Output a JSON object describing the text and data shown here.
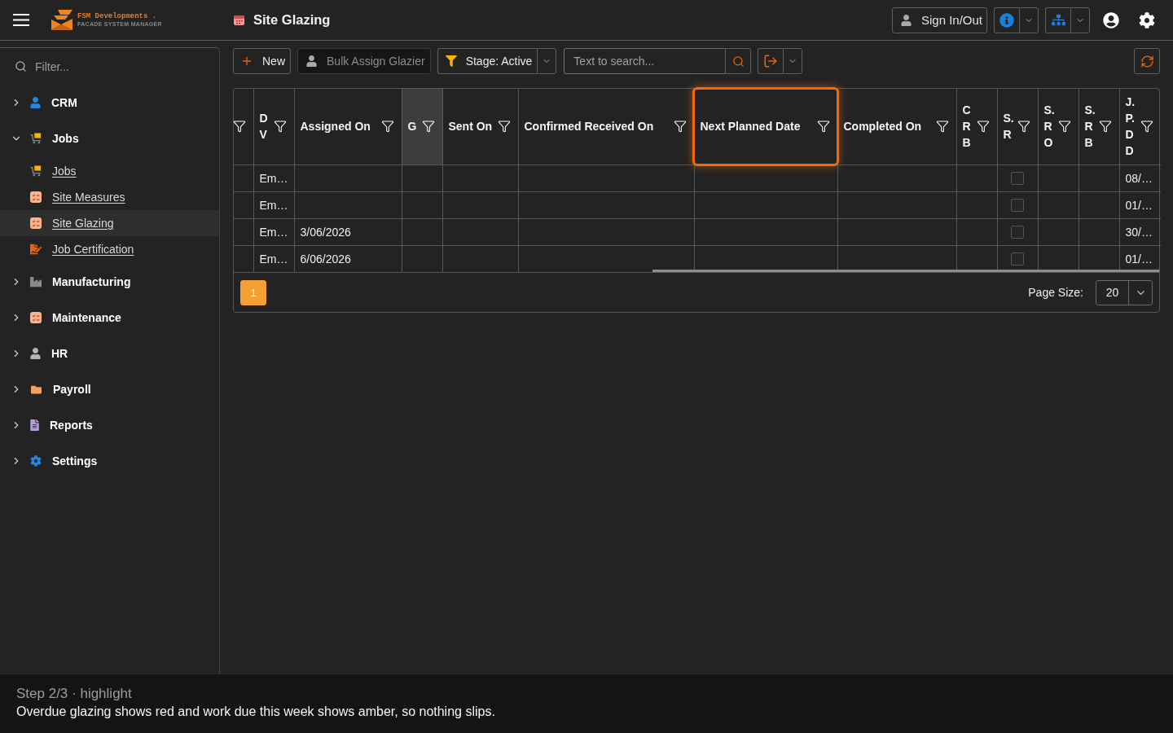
{
  "top_bar": {
    "brand_name": "FSM Developments .",
    "brand_tagline": "FACADE SYSTEM MANAGER",
    "page_title": "Site Glazing",
    "sign_in_button": "Sign In/Out"
  },
  "sidebar": {
    "filter": {
      "placeholder": "Filter..."
    },
    "items": [
      {
        "label": "CRM",
        "expanded": false
      },
      {
        "label": "Jobs",
        "expanded": true,
        "children": [
          {
            "label": "Jobs",
            "selected": false
          },
          {
            "label": "Site Measures",
            "selected": false
          },
          {
            "label": "Site Glazing",
            "selected": true
          },
          {
            "label": "Job Certification",
            "selected": false
          }
        ]
      },
      {
        "label": "Manufacturing",
        "expanded": false
      },
      {
        "label": "Maintenance",
        "expanded": false
      },
      {
        "label": "HR",
        "expanded": false
      },
      {
        "label": "Payroll",
        "expanded": false
      },
      {
        "label": "Reports",
        "expanded": false
      },
      {
        "label": "Settings",
        "expanded": false
      }
    ]
  },
  "toolbar": {
    "new_button": "New",
    "bulk_assign_button": {
      "label": "Bulk Assign Glazier",
      "disabled": true
    },
    "stage_filter": "Stage: Active",
    "search": {
      "placeholder": "Text to search..."
    }
  },
  "table": {
    "columns": [
      {
        "selected": false,
        "highlighted": false
      },
      {
        "label": "D V",
        "selected": false,
        "highlighted": false
      },
      {
        "label": "Assigned On",
        "selected": false,
        "highlighted": false
      },
      {
        "label": "G",
        "selected": true,
        "highlighted": false
      },
      {
        "label": "Sent On",
        "selected": false,
        "highlighted": false
      },
      {
        "label": "Confirmed Received On",
        "selected": false,
        "highlighted": false
      },
      {
        "label": "Next Planned Date",
        "selected": false,
        "highlighted": true
      },
      {
        "label": "Completed On",
        "selected": false,
        "highlighted": false
      },
      {
        "label": "C R B",
        "selected": false,
        "highlighted": false
      },
      {
        "label": "S. R",
        "selected": false,
        "highlighted": false
      },
      {
        "label": "S. R O",
        "selected": false,
        "highlighted": false
      },
      {
        "label": "S. R B",
        "selected": false,
        "highlighted": false
      },
      {
        "label": "J. P. D D",
        "selected": false,
        "highlighted": false
      }
    ],
    "rows": [
      {
        "d_v": "Em…",
        "s_r": {
          "checked": false
        },
        "j_p_d_d": "08/…"
      },
      {
        "d_v": "Em…",
        "s_r": {
          "checked": false
        },
        "j_p_d_d": "01/…"
      },
      {
        "d_v": "Em…",
        "assigned_on": "3/06/2026",
        "s_r": {
          "checked": false
        },
        "j_p_d_d": "30/…"
      },
      {
        "d_v": "Em…",
        "assigned_on": "6/06/2026",
        "s_r": {
          "checked": false
        },
        "j_p_d_d": "01/…"
      }
    ]
  },
  "pagination": {
    "pages": [
      {
        "label": "1",
        "selected": true
      }
    ],
    "page_size_label": "Page Size:",
    "page_size": "20"
  },
  "tour_caption": {
    "step": "Step 2/3 · highlight",
    "text": "Overdue glazing shows red and work due this week shows amber, so nothing slips."
  }
}
